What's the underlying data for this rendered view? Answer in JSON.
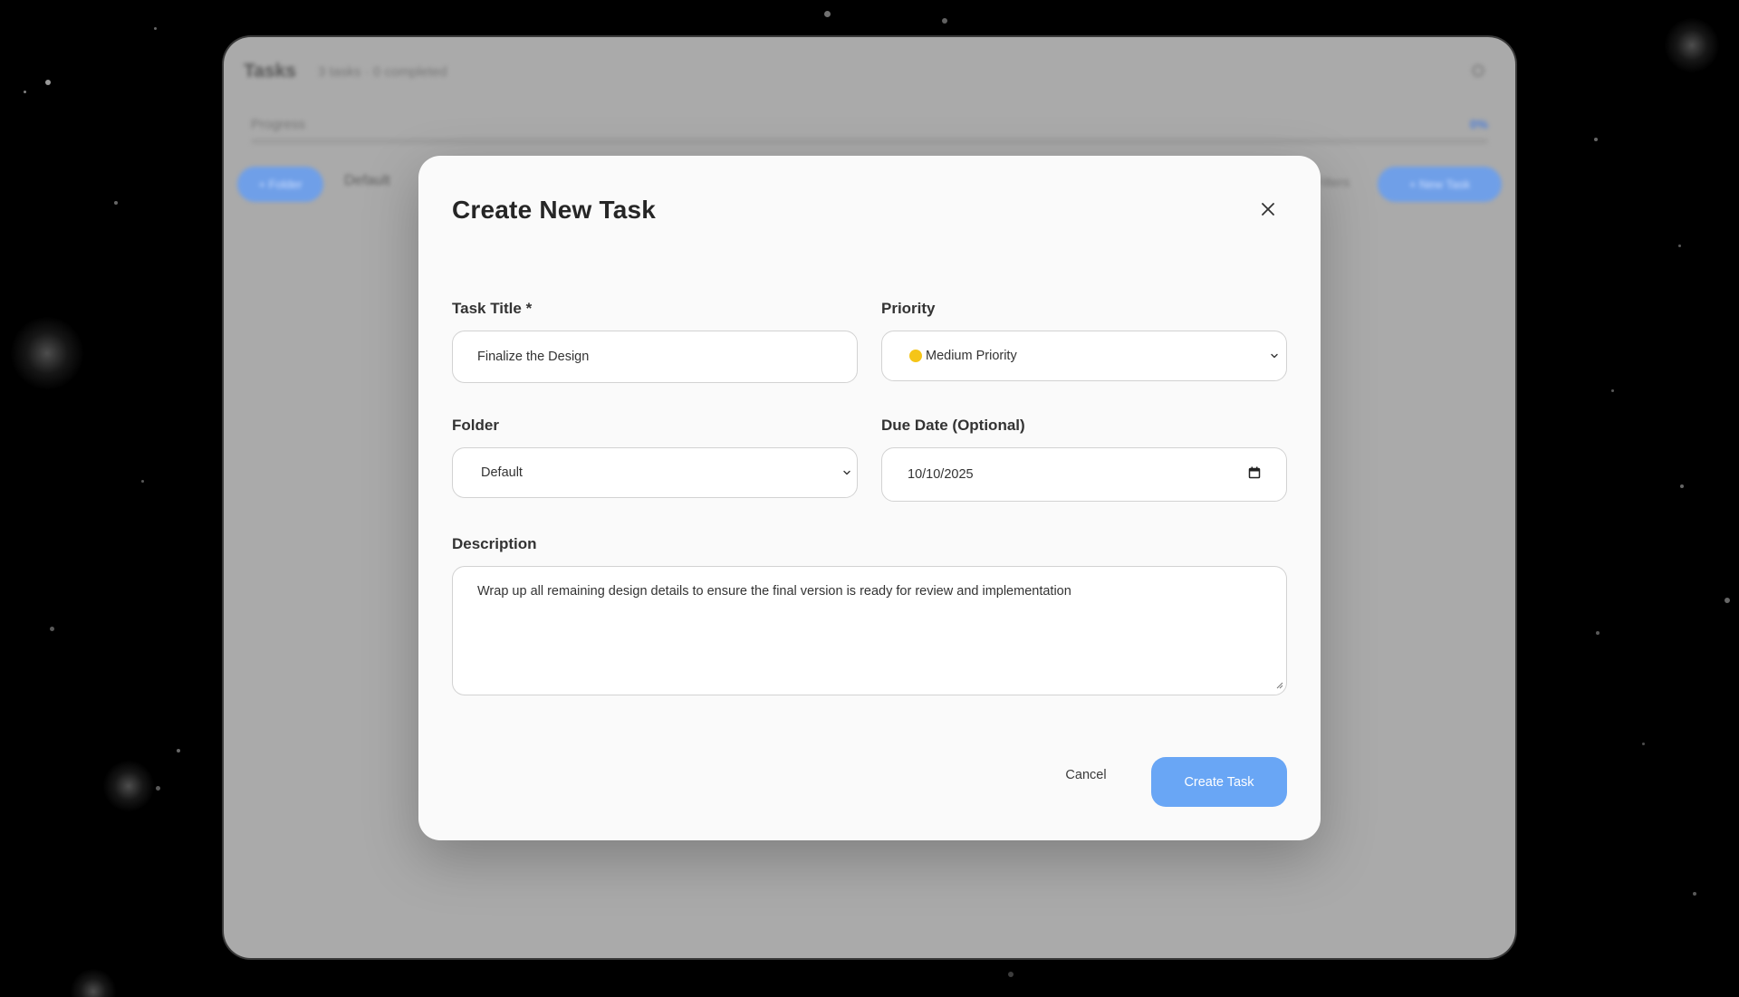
{
  "background_app": {
    "title": "Tasks",
    "stats": "3 tasks · 0 completed",
    "progress_label": "Progress",
    "progress_percent_text": "0%",
    "progress_value": 0,
    "folder_label": "Default",
    "left_pill_label": "+ Folder",
    "right_pill_label": "+ New Task",
    "filter_label": "Filters"
  },
  "modal": {
    "title": "Create New Task",
    "close_icon": "close-icon",
    "fields": {
      "task_title": {
        "label": "Task Title *",
        "value": "Finalize the Design"
      },
      "priority": {
        "label": "Priority",
        "value": "Medium Priority",
        "indicator_color": "#f5c518"
      },
      "folder": {
        "label": "Folder",
        "value": "Default"
      },
      "due_date": {
        "label": "Due Date (Optional)",
        "value": "10/10/2025",
        "icon": "calendar-icon"
      },
      "description": {
        "label": "Description",
        "value": "Wrap up all remaining design details to ensure the final version is ready for review and implementation"
      }
    },
    "buttons": {
      "cancel": "Cancel",
      "create": "Create Task"
    }
  },
  "colors": {
    "accent": "#69a6f5",
    "modal_bg": "#fafafa",
    "overlay": "#aaaaaa",
    "priority_medium": "#f5c518"
  }
}
